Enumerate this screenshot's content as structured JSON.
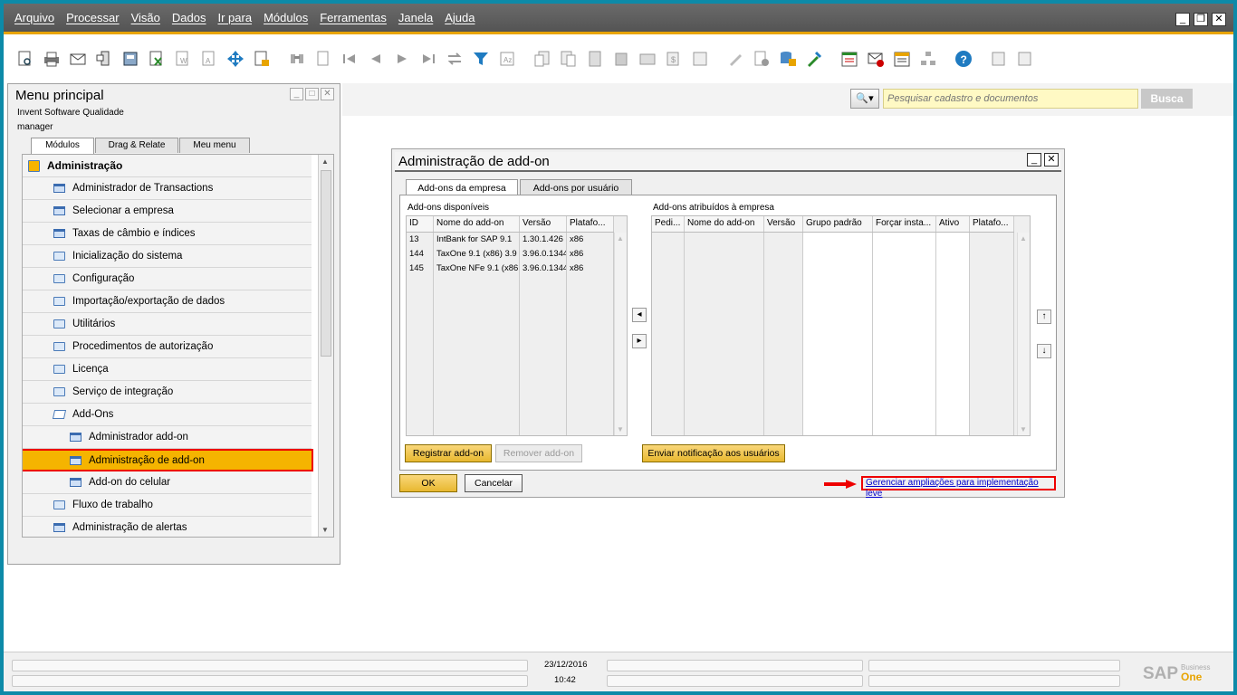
{
  "menubar": {
    "items": [
      "Arquivo",
      "Processar",
      "Visão",
      "Dados",
      "Ir para",
      "Módulos",
      "Ferramentas",
      "Janela",
      "Ajuda"
    ],
    "controls": [
      "_",
      "❐",
      "✕"
    ]
  },
  "search": {
    "dropdown_icon": "🔍▾",
    "placeholder": "Pesquisar cadastro e documentos",
    "button_label": "Busca"
  },
  "main_menu": {
    "title": "Menu principal",
    "company": "Invent Software Qualidade",
    "user": "manager",
    "tabs": [
      "Módulos",
      "Drag & Relate",
      "Meu menu"
    ],
    "items": [
      {
        "label": "Administração",
        "icon": "folder-module-icon",
        "indent": 0
      },
      {
        "label": "Administrador de Transactions",
        "icon": "window-icon",
        "indent": 1
      },
      {
        "label": "Selecionar a empresa",
        "icon": "window-icon",
        "indent": 1
      },
      {
        "label": "Taxas de câmbio e índices",
        "icon": "window-icon",
        "indent": 1
      },
      {
        "label": "Inicialização do sistema",
        "icon": "folder-icon",
        "indent": 1
      },
      {
        "label": "Configuração",
        "icon": "folder-icon",
        "indent": 1
      },
      {
        "label": "Importação/exportação de dados",
        "icon": "folder-icon",
        "indent": 1
      },
      {
        "label": "Utilitários",
        "icon": "folder-icon",
        "indent": 1
      },
      {
        "label": "Procedimentos de autorização",
        "icon": "folder-icon",
        "indent": 1
      },
      {
        "label": "Licença",
        "icon": "folder-icon",
        "indent": 1
      },
      {
        "label": "Serviço de integração",
        "icon": "folder-icon",
        "indent": 1
      },
      {
        "label": "Add-Ons",
        "icon": "folder-open-icon",
        "indent": 1
      },
      {
        "label": "Administrador add-on",
        "icon": "window-icon",
        "indent": 2
      },
      {
        "label": "Administração de add-on",
        "icon": "window-icon",
        "indent": 2,
        "selected": true
      },
      {
        "label": "Add-on do celular",
        "icon": "window-icon",
        "indent": 2
      },
      {
        "label": "Fluxo de trabalho",
        "icon": "folder-icon",
        "indent": 1
      },
      {
        "label": "Administração de alertas",
        "icon": "window-icon",
        "indent": 1
      }
    ]
  },
  "dialog": {
    "title": "Administração de add-on",
    "tabs": [
      "Add-ons da empresa",
      "Add-ons por usuário"
    ],
    "available": {
      "label": "Add-ons disponíveis",
      "columns": [
        "ID",
        "Nome do add-on",
        "Versão",
        "Platafo..."
      ],
      "rows": [
        [
          "13",
          "IntBank for SAP 9.1",
          "1.30.1.426",
          "x86"
        ],
        [
          "144",
          "TaxOne 9.1 (x86) 3.9",
          "3.96.0.1344",
          "x86"
        ],
        [
          "145",
          "TaxOne NFe 9.1 (x86",
          "3.96.0.1344",
          "x86"
        ]
      ]
    },
    "assigned": {
      "label": "Add-ons atribuídos à empresa",
      "columns": [
        "Pedi...",
        "Nome do add-on",
        "Versão",
        "Grupo padrão",
        "Forçar insta...",
        "Ativo",
        "Platafo..."
      ]
    },
    "buttons": {
      "register": "Registrar add-on",
      "remove": "Remover add-on",
      "notify": "Enviar notificação aos usuários",
      "ok": "OK",
      "cancel": "Cancelar"
    },
    "link": "Gerenciar ampliações para implementação leve"
  },
  "status": {
    "date": "23/12/2016",
    "time": "10:42",
    "logo": "SAP",
    "logo_sub1": "Business",
    "logo_sub2": "One"
  },
  "colors": {
    "accent": "#f5b400",
    "frame": "#0d8aa8",
    "highlight_border": "#e00000",
    "link": "#0000cc"
  }
}
